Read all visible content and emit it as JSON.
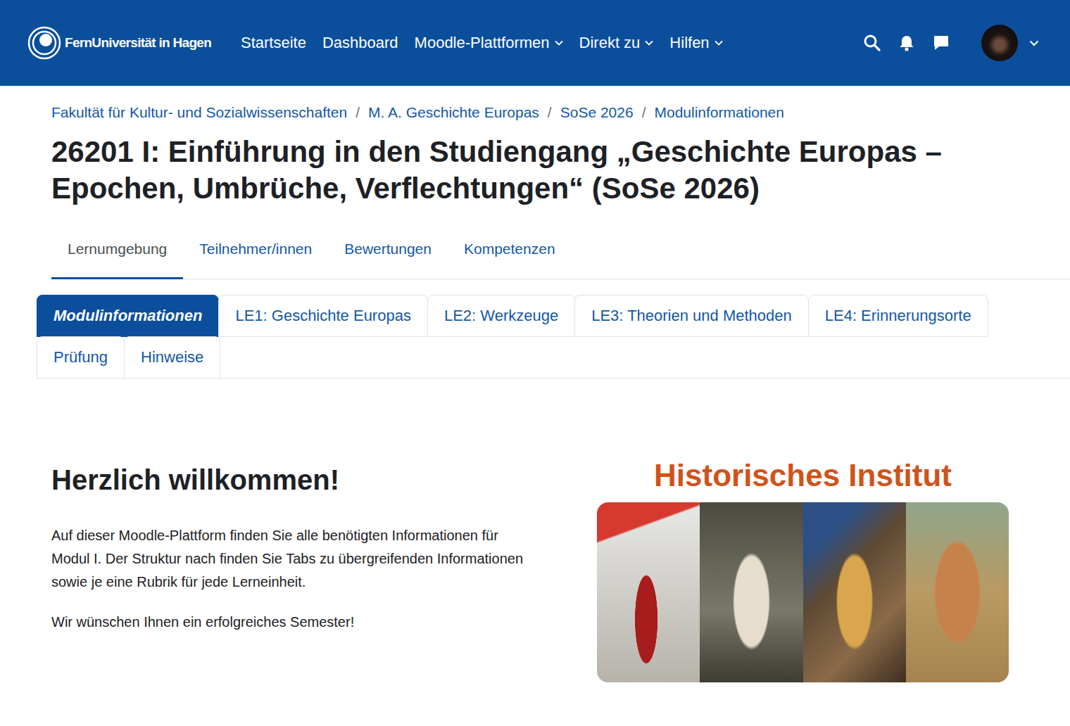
{
  "brand": {
    "name": "FernUniversität in Hagen"
  },
  "nav": {
    "items": [
      {
        "label": "Startseite",
        "dropdown": false
      },
      {
        "label": "Dashboard",
        "dropdown": false
      },
      {
        "label": "Moodle-Plattformen",
        "dropdown": true
      },
      {
        "label": "Direkt zu",
        "dropdown": true
      },
      {
        "label": "Hilfen",
        "dropdown": true
      }
    ]
  },
  "breadcrumb": [
    "Fakultät für Kultur- und Sozialwissenschaften",
    "M. A. Geschichte Europas",
    "SoSe 2026",
    "Modulinformationen"
  ],
  "breadcrumb_separator": "/",
  "page_title": "26201 I: Einführung in den Studiengang „Geschichte Europas – Epochen, Umbrüche, Verflechtungen“ (SoSe 2026)",
  "secondary_tabs": [
    {
      "label": "Lernumgebung",
      "selected": true
    },
    {
      "label": "Teilnehmer/innen",
      "selected": false
    },
    {
      "label": "Bewertungen",
      "selected": false
    },
    {
      "label": "Kompetenzen",
      "selected": false
    }
  ],
  "course_tabs": [
    {
      "label": "Modulinformationen",
      "selected": true
    },
    {
      "label": "LE1: Geschichte Europas",
      "selected": false
    },
    {
      "label": "LE2: Werkzeuge",
      "selected": false
    },
    {
      "label": "LE3: Theorien und Methoden",
      "selected": false
    },
    {
      "label": "LE4: Erinnerungsorte",
      "selected": false
    },
    {
      "label": "Prüfung",
      "selected": false
    },
    {
      "label": "Hinweise",
      "selected": false
    }
  ],
  "welcome": {
    "heading": "Herzlich willkommen!",
    "paragraphs": [
      "Auf dieser Moodle-Plattform finden Sie alle benötigten Informationen für Modul I. Der Struktur nach finden Sie Tabs zu übergreifenden Informationen sowie je eine Rubrik für jede Lerneinheit.",
      "Wir wünschen Ihnen ein erfolgreiches Semester!"
    ]
  },
  "institute": {
    "title": "Historisches Institut"
  }
}
